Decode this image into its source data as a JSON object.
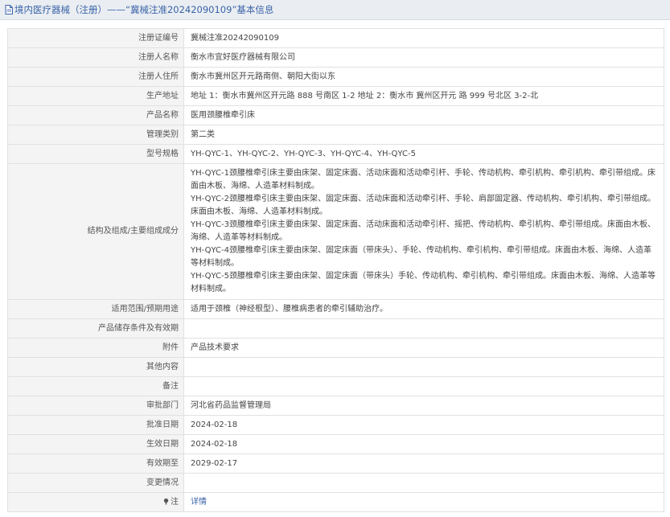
{
  "header": {
    "icon": "document-icon",
    "title": "境内医疗器械（注册）——“冀械注准20242090109”基本信息"
  },
  "rows": [
    {
      "key": "注册证编号",
      "value": "冀械注准20242090109"
    },
    {
      "key": "注册人名称",
      "value": "衡水市宜好医疗器械有限公司"
    },
    {
      "key": "注册人住所",
      "value": "衡水市冀州区开元路南侧、朝阳大街以东"
    },
    {
      "key": "生产地址",
      "value": "地址 1：衡水市冀州区开元路 888 号南区 1-2 地址 2：衡水市 冀州区开元 路 999 号北区 3-2-北"
    },
    {
      "key": "产品名称",
      "value": "医用颈腰椎牵引床"
    },
    {
      "key": "管理类别",
      "value": "第二类"
    },
    {
      "key": "型号规格",
      "value": "YH-QYC-1、YH-QYC-2、YH-QYC-3、YH-QYC-4、YH-QYC-5"
    }
  ],
  "structure": {
    "key": "结构及组成/主要组成成分",
    "lines": [
      "YH-QYC-1颈腰椎牵引床主要由床架、固定床面、活动床面和活动牵引杆、手轮、传动机构、牵引机构、牵引机构、牵引带组成。床面由木板、海绵、人造革材料制成。",
      "YH-QYC-2颈腰椎牵引床主要由床架、固定床面、活动床面和活动牵引杆、手轮、肩部固定器、传动机构、牵引机构、牵引带组成。床面由木板、海绵、人造革材料制成。",
      "YH-QYC-3颈腰椎牵引床主要由床架、固定床面、活动床面和活动牵引杆、摇把、传动机构、牵引机构、牵引带组成。床面由木板、海绵、人造革等材料制成。",
      "YH-QYC-4颈腰椎牵引床主要由床架、固定床面（带床头）、手轮、传动机构、牵引机构、牵引带组成。床面由木板、海绵、人造革等材料制成。",
      "YH-QYC-5颈腰椎牵引床主要由床架、固定床面（带床头）手轮、传动机构、牵引机构、牵引带组成。床面由木板、海绵、人造革等材料制成。"
    ]
  },
  "rows2": [
    {
      "key": "适用范围/预期用途",
      "value": "适用于颈椎（神经根型）、腰椎病患者的牵引辅助治疗。"
    },
    {
      "key": "产品储存条件及有效期",
      "value": ""
    },
    {
      "key": "附件",
      "value": "产品技术要求"
    },
    {
      "key": "其他内容",
      "value": ""
    },
    {
      "key": "备注",
      "value": ""
    },
    {
      "key": "审批部门",
      "value": "河北省药品监督管理局"
    },
    {
      "key": "批准日期",
      "value": "2024-02-18"
    },
    {
      "key": "生效日期",
      "value": "2024-02-18"
    },
    {
      "key": "有效期至",
      "value": "2029-02-17"
    },
    {
      "key": "变更情况",
      "value": ""
    }
  ],
  "footer_row": {
    "key": "注",
    "icon": "star-icon",
    "link": "详情"
  }
}
